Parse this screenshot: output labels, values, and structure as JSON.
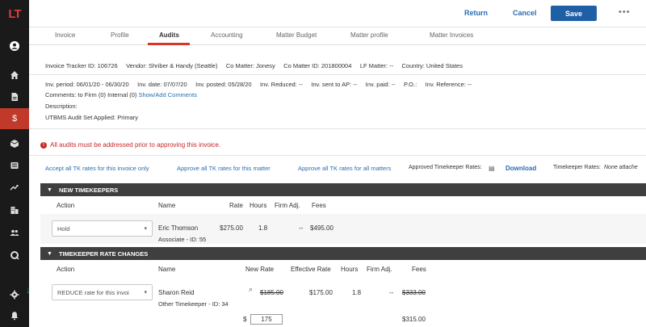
{
  "app": {
    "logo": "LT"
  },
  "sidebar": {
    "icons": [
      "user-icon",
      "home-icon",
      "document-icon",
      "dollar-icon",
      "box-icon",
      "news-icon",
      "trend-icon",
      "building-icon",
      "people-icon",
      "search-icon",
      "gear-icon",
      "bell-icon"
    ],
    "active": "dollar-icon"
  },
  "topbar": {
    "return_label": "Return",
    "cancel_label": "Cancel",
    "save_label": "Save",
    "more_label": "•••"
  },
  "tabs": [
    {
      "label": "Invoice"
    },
    {
      "label": "Profile"
    },
    {
      "label": "Audits"
    },
    {
      "label": "Accounting"
    },
    {
      "label": "Matter Budget"
    },
    {
      "label": "Matter profile"
    },
    {
      "label": "Matter Invoices"
    }
  ],
  "invoice_header": {
    "tracker": "Invoice Tracker ID:  106726",
    "vendor": "Vendor:  Shriber & Handy (Seattle)",
    "co_matter": "Co Matter:  Jonesy",
    "co_matter_id": "Co Matter ID:  201800004",
    "lf_matter": "LF Matter:  --",
    "country": "Country:  United States"
  },
  "invoice_details": {
    "period": "Inv. period:  06/01/20 - 06/30/20",
    "date": "Inv. date:  07/07/20",
    "posted": "Inv. posted:  05/28/20",
    "reduced": "Inv. Reduced:  --",
    "sent_ap": "Inv. sent to AP:  --",
    "paid": "Inv. paid:  --",
    "po": "P.O.:",
    "reference": "Inv. Reference:  --",
    "comments_prefix": "Comments:  to Firm (0) Internal (0)",
    "comments_link": "Show/Add Comments",
    "description": "Description:",
    "utbms": "UTBMS Audit Set Applied:  Primary"
  },
  "error_message": "All audits must be addressed prior to approving this invoice.",
  "rate_actions": {
    "accept_invoice": "Accept all TK rates for this invoice only",
    "approve_matter": "Approve all TK rates for this matter",
    "approve_all": "Approve all TK rates for all matters",
    "approved_label": "Approved Timekeeper Rates:",
    "download": "Download",
    "tk_rates_label": "Timekeeper Rates:",
    "tk_rates_value": "None attache"
  },
  "new_timekeepers": {
    "title": "NEW TIMEKEEPERS",
    "headers": {
      "action": "Action",
      "name": "Name",
      "rate": "Rate",
      "hours": "Hours",
      "firm_adj": "Firm Adj.",
      "fees": "Fees"
    },
    "rows": [
      {
        "action": "Hold",
        "name": "Eric Thomson",
        "sub": "Associate - ID: 55",
        "rate": "$275.00",
        "hours": "1.8",
        "firm_adj": "--",
        "fees": "$495.00"
      }
    ]
  },
  "rate_changes": {
    "title": "TIMEKEEPER RATE CHANGES",
    "headers": {
      "action": "Action",
      "name": "Name",
      "new_rate": "New Rate",
      "effective_rate": "Effective Rate",
      "hours": "Hours",
      "firm_adj": "Firm Adj.",
      "fees": "Fees"
    },
    "rows": [
      {
        "action": "REDUCE rate for this invoi",
        "name": "Sharon Reid",
        "sub": "Other Timekeeper - ID: 34",
        "new_rate": "$185.00",
        "effective_rate": "$175.00",
        "hours": "1.8",
        "firm_adj": "--",
        "fees": "$333.00",
        "input_prefix": "$",
        "input_value": "175",
        "reduced_fees": "$315.00"
      }
    ]
  },
  "colors": {
    "sidebar": "#1a1a1a",
    "accent_red": "#c0392b",
    "link_blue": "#2a6db5",
    "save_blue": "#1f5fa6",
    "section_bar": "#3f3f3f",
    "error_red": "#c62828",
    "green_arrow": "#2e8b3a"
  }
}
